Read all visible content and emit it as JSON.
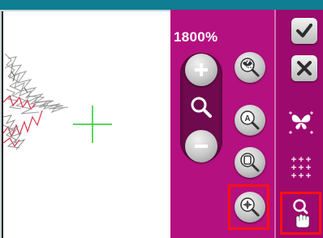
{
  "zoom": {
    "level_text": "1800%"
  },
  "icons": {
    "confirm": "checkmark-icon",
    "cancel": "close-icon",
    "zoom_in": "plus-icon",
    "zoom_out": "minus-icon",
    "magnifier": "magnifier-icon",
    "zoom_selection": "zoom-to-selection-icon",
    "zoom_all": "zoom-to-all-icon",
    "zoom_hoop": "zoom-to-hoop-icon",
    "zoom_cursor": "zoom-to-cursor-icon",
    "butterfly": "butterfly-center-icon",
    "grid": "grid-icon",
    "pan": "pan-hand-icon"
  },
  "colors": {
    "panel": "#b4107f",
    "highlight": "#ff1010",
    "crosshair": "#22cc22",
    "stitch_red": "#d8344c"
  }
}
